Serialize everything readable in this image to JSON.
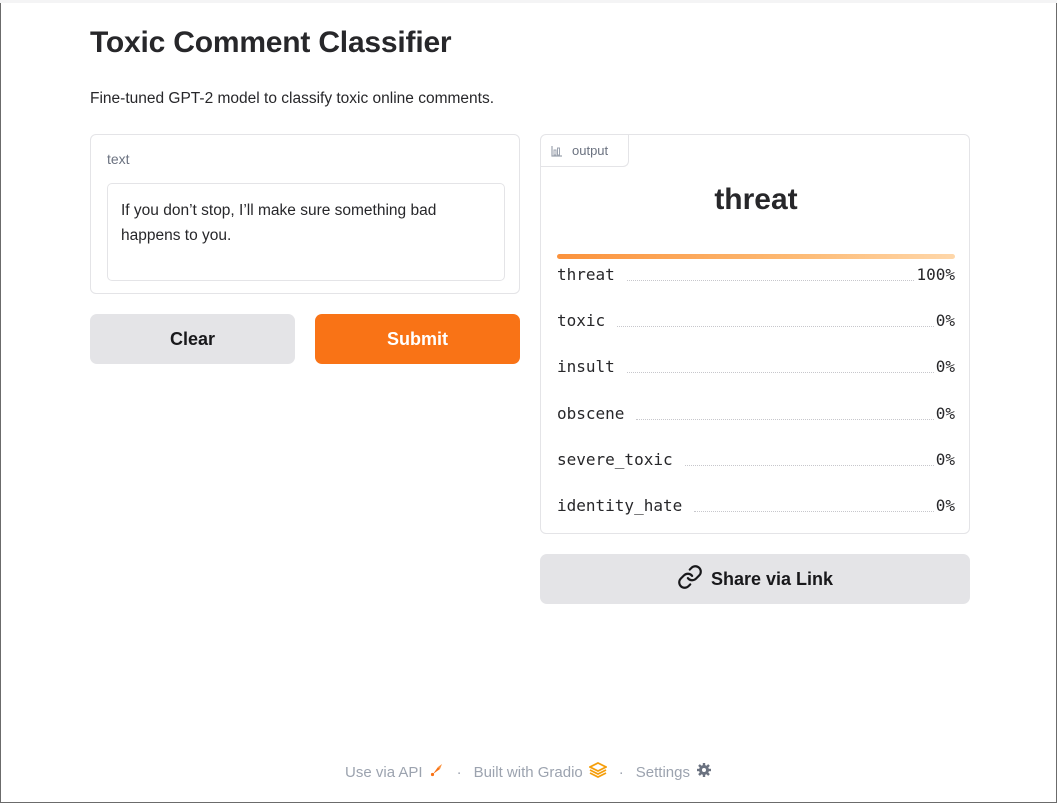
{
  "header": {
    "title": "Toxic Comment Classifier",
    "description": "Fine-tuned GPT-2 model to classify toxic online comments."
  },
  "input": {
    "label": "text",
    "value": "If you don’t stop, I’ll make sure something bad happens to you."
  },
  "buttons": {
    "clear_label": "Clear",
    "submit_label": "Submit",
    "share_label": "Share via Link"
  },
  "output": {
    "tab_label": "output",
    "predicted_label": "threat",
    "top_confidence": 1.0,
    "rows": [
      {
        "label": "threat",
        "value": "100%"
      },
      {
        "label": "toxic",
        "value": "0%"
      },
      {
        "label": "insult",
        "value": "0%"
      },
      {
        "label": "obscene",
        "value": "0%"
      },
      {
        "label": "severe_toxic",
        "value": "0%"
      },
      {
        "label": "identity_hate",
        "value": "0%"
      }
    ]
  },
  "footer": {
    "api_label": "Use via API",
    "gradio_label": "Built with Gradio",
    "settings_label": "Settings",
    "separator": "·"
  },
  "colors": {
    "accent": "#f97316",
    "button_secondary": "#e4e4e7"
  },
  "icons": {
    "tab": "bar-chart-icon",
    "share": "link-icon",
    "api": "rocket-icon",
    "gradio": "gradio-logo-icon",
    "settings": "gear-icon"
  }
}
